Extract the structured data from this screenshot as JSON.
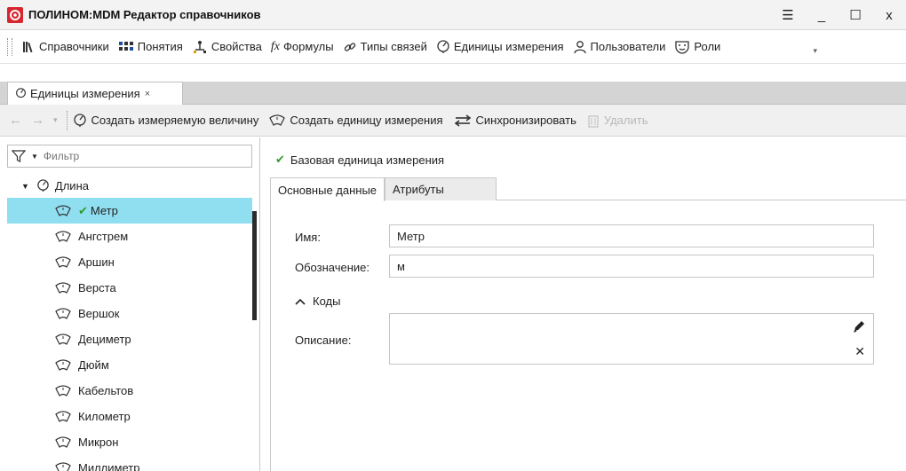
{
  "window": {
    "title": "ПОЛИНОМ:MDM Редактор справочников",
    "controls": {
      "menu": "☰",
      "minimize": "_",
      "maximize": "☐",
      "close": "x"
    }
  },
  "menubar": {
    "items": [
      {
        "label": "Справочники",
        "icon": "books-icon"
      },
      {
        "label": "Понятия",
        "icon": "concepts-icon"
      },
      {
        "label": "Свойства",
        "icon": "properties-icon"
      },
      {
        "label": "Формулы",
        "icon": "fx-icon"
      },
      {
        "label": "Типы связей",
        "icon": "link-icon"
      },
      {
        "label": "Единицы измерения",
        "icon": "units-icon"
      },
      {
        "label": "Пользователи",
        "icon": "user-icon"
      },
      {
        "label": "Роли",
        "icon": "masks-icon"
      }
    ]
  },
  "doc_tab": {
    "label": "Единицы измерения",
    "close": "×"
  },
  "toolbar": {
    "back": "←",
    "forward": "→",
    "create_quantity": "Создать измеряемую величину",
    "create_unit": "Создать единицу измерения",
    "sync": "Синхронизировать",
    "delete": "Удалить"
  },
  "filter": {
    "placeholder": "Фильтр"
  },
  "tree": {
    "root": "Длина",
    "items": [
      {
        "label": "Метр",
        "selected": true,
        "base": true
      },
      {
        "label": "Ангстрем"
      },
      {
        "label": "Аршин"
      },
      {
        "label": "Верста"
      },
      {
        "label": "Вершок"
      },
      {
        "label": "Дециметр"
      },
      {
        "label": "Дюйм"
      },
      {
        "label": "Кабельтов"
      },
      {
        "label": "Километр"
      },
      {
        "label": "Микрон"
      },
      {
        "label": "Миллиметр"
      }
    ]
  },
  "detail": {
    "base_unit_label": "Базовая единица измерения",
    "tabs": [
      "Основные данные",
      "Атрибуты"
    ],
    "name_label": "Имя:",
    "name_value": "Метр",
    "symbol_label": "Обозначение:",
    "symbol_value": "м",
    "codes_label": "Коды",
    "description_label": "Описание:",
    "description_value": ""
  },
  "colors": {
    "selection": "#90dff0",
    "check": "#2c9a2c",
    "logo": "#d8262e"
  }
}
